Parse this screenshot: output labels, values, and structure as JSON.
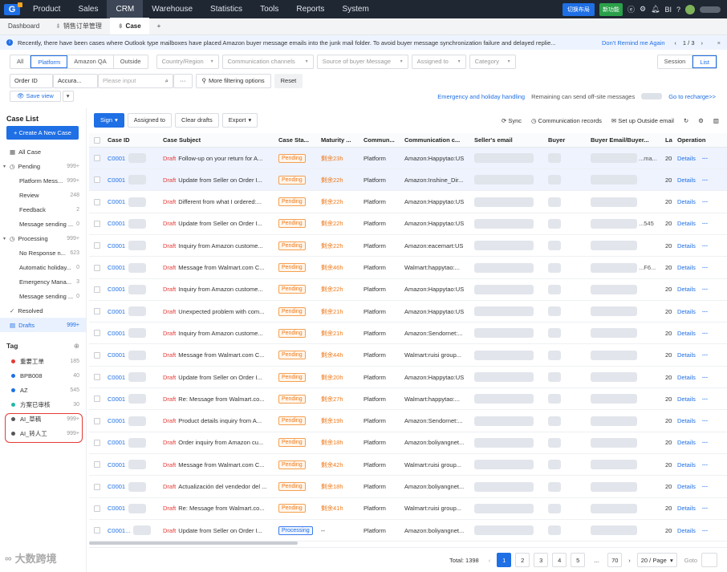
{
  "topnav": {
    "items": [
      "Product",
      "Sales",
      "CRM",
      "Warehouse",
      "Statistics",
      "Tools",
      "Reports",
      "System"
    ],
    "active": "CRM",
    "switch_layout": "切换布局",
    "new_feature": "新功能",
    "bi": "BI"
  },
  "tabs": {
    "dashboard": "Dashboard",
    "sales_orders": "销售订单管理",
    "case": "Case",
    "add": "+"
  },
  "notice": {
    "message": "Recently, there have been cases where Outlook type mailboxes have placed Amazon buyer message emails into the junk mail folder. To avoid buyer message synchronization failure and delayed replie...",
    "dont_remind": "Don't Remind me Again",
    "pager": "1 / 3"
  },
  "filters": {
    "platform_seg": [
      "All",
      "Platform",
      "Amazon QA",
      "Outside"
    ],
    "platform_active": "Platform",
    "country": "Country/Region",
    "channels": "Communication channels",
    "source": "Source of buyer Message",
    "assigned": "Assigned to",
    "category": "Category",
    "view_seg": [
      "Session",
      "List"
    ],
    "view_active": "List",
    "order_id": "Order ID",
    "accuracy": "Accura...",
    "input_placeholder": "Please input",
    "more_filter": "More filtering options",
    "reset": "Reset",
    "save_view": "Save view",
    "emergency": "Emergency and holiday handling",
    "remaining": "Remaining can send off-site messages",
    "recharge": "Go to recharge>>"
  },
  "sidebar": {
    "title": "Case List",
    "new_case": "+ Create A New Case",
    "items": [
      {
        "label": "All Case",
        "count": "",
        "indent": 0,
        "icon": "grid-icon"
      },
      {
        "label": "Pending",
        "count": "999+",
        "indent": 0,
        "icon": "clock-icon",
        "expand": true
      },
      {
        "label": "Platform Mess...",
        "count": "999+",
        "indent": 1
      },
      {
        "label": "Review",
        "count": "248",
        "indent": 1
      },
      {
        "label": "Feedback",
        "count": "2",
        "indent": 1
      },
      {
        "label": "Message sending ...",
        "count": "0",
        "indent": 1
      },
      {
        "label": "Processing",
        "count": "999+",
        "indent": 0,
        "icon": "clock-icon",
        "expand": true
      },
      {
        "label": "No Response n...",
        "count": "623",
        "indent": 1
      },
      {
        "label": "Automatic holiday...",
        "count": "0",
        "indent": 1
      },
      {
        "label": "Emergency Mana...",
        "count": "3",
        "indent": 1
      },
      {
        "label": "Message sending ...",
        "count": "0",
        "indent": 1
      },
      {
        "label": "Resolved",
        "count": "",
        "indent": 0,
        "icon": "check-icon"
      },
      {
        "label": "Drafts",
        "count": "999+",
        "indent": 0,
        "icon": "inbox-icon",
        "active": true
      }
    ],
    "tag_title": "Tag",
    "tags": [
      {
        "label": "重要工单",
        "count": "185",
        "color": "#e53935"
      },
      {
        "label": "BPB008",
        "count": "40",
        "color": "#1f6fe5"
      },
      {
        "label": "AZ",
        "count": "545",
        "color": "#1f6fe5"
      },
      {
        "label": "方案已审核",
        "count": "30",
        "color": "#22b8a8"
      },
      {
        "label": "AI_草稿",
        "count": "999+",
        "color": "#555"
      },
      {
        "label": "AI_转人工",
        "count": "999+",
        "color": "#555"
      }
    ]
  },
  "toolbar": {
    "sign": "Sign",
    "assigned_to": "Assigned to",
    "clear_drafts": "Clear drafts",
    "export": "Export",
    "sync": "Sync",
    "comm_records": "Communication records",
    "setup_email": "Set up Outside email"
  },
  "table": {
    "headers": [
      "Case ID",
      "Case Subject",
      "Case Sta...",
      "Maturity ...",
      "Commun...",
      "Communication c...",
      "Seller's email",
      "Buyer",
      "Buyer Email/Buyer...",
      "La",
      "Operation"
    ],
    "draft_label": "Draft",
    "details_label": "Details",
    "rows": [
      {
        "id": "C0001",
        "subject": "Follow-up on your return for A...",
        "status": "Pending",
        "maturity": "剩余23h",
        "comm": "Platform",
        "channel": "Amazon:Happytao:US",
        "buyer_email": "...ma...",
        "la": "20",
        "sel": true
      },
      {
        "id": "C0001",
        "subject": "Update from Seller on Order I...",
        "status": "Pending",
        "maturity": "剩余22h",
        "comm": "Platform",
        "channel": "Amazon:Inshine_Dir...",
        "buyer_email": "",
        "la": "20",
        "sel": true
      },
      {
        "id": "C0001",
        "subject": "Different from what I ordered:...",
        "status": "Pending",
        "maturity": "剩余22h",
        "comm": "Platform",
        "channel": "Amazon:Happytao:US",
        "buyer_email": "",
        "la": "20"
      },
      {
        "id": "C0001",
        "subject": "Update from Seller on Order I...",
        "status": "Pending",
        "maturity": "剩余22h",
        "comm": "Platform",
        "channel": "Amazon:Happytao:US",
        "buyer_email": "...545",
        "la": "20"
      },
      {
        "id": "C0001",
        "subject": "Inquiry from Amazon custome...",
        "status": "Pending",
        "maturity": "剩余22h",
        "comm": "Platform",
        "channel": "Amazon:eacemart:US",
        "buyer_email": "",
        "la": "20"
      },
      {
        "id": "C0001",
        "subject": "Message from Walmart.com C...",
        "status": "Pending",
        "maturity": "剩余46h",
        "comm": "Platform",
        "channel": "Walmart:happytao:...",
        "buyer_email": "...F6...",
        "la": "20"
      },
      {
        "id": "C0001",
        "subject": "Inquiry from Amazon custome...",
        "status": "Pending",
        "maturity": "剩余22h",
        "comm": "Platform",
        "channel": "Amazon:Happytao:US",
        "buyer_email": "",
        "la": "20"
      },
      {
        "id": "C0001",
        "subject": "Unexpected problem with com...",
        "status": "Pending",
        "maturity": "剩余21h",
        "comm": "Platform",
        "channel": "Amazon:Happytao:US",
        "buyer_email": "",
        "la": "20"
      },
      {
        "id": "C0001",
        "subject": "Inquiry from Amazon custome...",
        "status": "Pending",
        "maturity": "剩余21h",
        "comm": "Platform",
        "channel": "Amazon:Sendornet:...",
        "buyer_email": "",
        "la": "20"
      },
      {
        "id": "C0001",
        "subject": "Message from Walmart.com C...",
        "status": "Pending",
        "maturity": "剩余44h",
        "comm": "Platform",
        "channel": "Walmart:ruisi group...",
        "buyer_email": "",
        "la": "20"
      },
      {
        "id": "C0001",
        "subject": "Update from Seller on Order I...",
        "status": "Pending",
        "maturity": "剩余20h",
        "comm": "Platform",
        "channel": "Amazon:Happytao:US",
        "buyer_email": "",
        "la": "20"
      },
      {
        "id": "C0001",
        "subject": "Re: Message from Walmart.co...",
        "status": "Pending",
        "maturity": "剩余27h",
        "comm": "Platform",
        "channel": "Walmart:happytao:...",
        "buyer_email": "",
        "la": "20"
      },
      {
        "id": "C0001",
        "subject": "Product details inquiry from A...",
        "status": "Pending",
        "maturity": "剩余19h",
        "comm": "Platform",
        "channel": "Amazon:Sendornet:...",
        "buyer_email": "",
        "la": "20"
      },
      {
        "id": "C0001",
        "subject": "Order inquiry from Amazon cu...",
        "status": "Pending",
        "maturity": "剩余18h",
        "comm": "Platform",
        "channel": "Amazon:boliyangnet...",
        "buyer_email": "",
        "la": "20"
      },
      {
        "id": "C0001",
        "subject": "Message from Walmart.com C...",
        "status": "Pending",
        "maturity": "剩余42h",
        "comm": "Platform",
        "channel": "Walmart:ruisi group...",
        "buyer_email": "",
        "la": "20"
      },
      {
        "id": "C0001",
        "subject": "Actualización del vendedor del ...",
        "status": "Pending",
        "maturity": "剩余18h",
        "comm": "Platform",
        "channel": "Amazon:boliyangnet...",
        "buyer_email": "",
        "la": "20"
      },
      {
        "id": "C0001",
        "subject": "Re: Message from Walmart.co...",
        "status": "Pending",
        "maturity": "剩余41h",
        "comm": "Platform",
        "channel": "Walmart:ruisi group...",
        "buyer_email": "",
        "la": "20"
      },
      {
        "id": "C0001...",
        "subject": "Update from Seller on Order I...",
        "status": "Processing",
        "maturity": "--",
        "comm": "Platform",
        "channel": "Amazon:boliyangnet...",
        "buyer_email": "",
        "la": "20"
      }
    ]
  },
  "pagination": {
    "total": "Total: 1398",
    "pages": [
      "1",
      "2",
      "3",
      "4",
      "5",
      "...",
      "70"
    ],
    "per_page": "20 / Page",
    "goto": "Goto"
  },
  "brand": "大数跨境"
}
